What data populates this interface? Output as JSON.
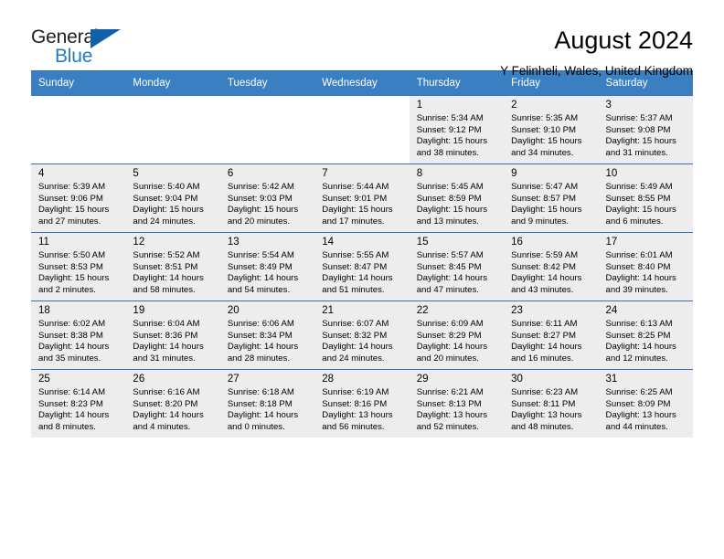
{
  "brand": {
    "name_part1": "General",
    "name_part2": "Blue",
    "logo_icon": "triangle-flag-icon",
    "accent_color": "#1161a8",
    "blue_text_color": "#1d7dc4"
  },
  "header": {
    "title": "August 2024",
    "subtitle": "Y Felinheli, Wales, United Kingdom"
  },
  "calendar": {
    "header_bg": "#3a7fc1",
    "header_text_color": "#ffffff",
    "shaded_cell_color": "#ededed",
    "border_color": "#2e74b5",
    "weekday_headers": [
      "Sunday",
      "Monday",
      "Tuesday",
      "Wednesday",
      "Thursday",
      "Friday",
      "Saturday"
    ],
    "weeks": [
      [
        {
          "day": "",
          "sunrise": "",
          "sunset": "",
          "daylight_line1": "",
          "daylight_line2": ""
        },
        {
          "day": "",
          "sunrise": "",
          "sunset": "",
          "daylight_line1": "",
          "daylight_line2": ""
        },
        {
          "day": "",
          "sunrise": "",
          "sunset": "",
          "daylight_line1": "",
          "daylight_line2": ""
        },
        {
          "day": "",
          "sunrise": "",
          "sunset": "",
          "daylight_line1": "",
          "daylight_line2": ""
        },
        {
          "day": "1",
          "sunrise": "Sunrise: 5:34 AM",
          "sunset": "Sunset: 9:12 PM",
          "daylight_line1": "Daylight: 15 hours",
          "daylight_line2": "and 38 minutes."
        },
        {
          "day": "2",
          "sunrise": "Sunrise: 5:35 AM",
          "sunset": "Sunset: 9:10 PM",
          "daylight_line1": "Daylight: 15 hours",
          "daylight_line2": "and 34 minutes."
        },
        {
          "day": "3",
          "sunrise": "Sunrise: 5:37 AM",
          "sunset": "Sunset: 9:08 PM",
          "daylight_line1": "Daylight: 15 hours",
          "daylight_line2": "and 31 minutes."
        }
      ],
      [
        {
          "day": "4",
          "sunrise": "Sunrise: 5:39 AM",
          "sunset": "Sunset: 9:06 PM",
          "daylight_line1": "Daylight: 15 hours",
          "daylight_line2": "and 27 minutes."
        },
        {
          "day": "5",
          "sunrise": "Sunrise: 5:40 AM",
          "sunset": "Sunset: 9:04 PM",
          "daylight_line1": "Daylight: 15 hours",
          "daylight_line2": "and 24 minutes."
        },
        {
          "day": "6",
          "sunrise": "Sunrise: 5:42 AM",
          "sunset": "Sunset: 9:03 PM",
          "daylight_line1": "Daylight: 15 hours",
          "daylight_line2": "and 20 minutes."
        },
        {
          "day": "7",
          "sunrise": "Sunrise: 5:44 AM",
          "sunset": "Sunset: 9:01 PM",
          "daylight_line1": "Daylight: 15 hours",
          "daylight_line2": "and 17 minutes."
        },
        {
          "day": "8",
          "sunrise": "Sunrise: 5:45 AM",
          "sunset": "Sunset: 8:59 PM",
          "daylight_line1": "Daylight: 15 hours",
          "daylight_line2": "and 13 minutes."
        },
        {
          "day": "9",
          "sunrise": "Sunrise: 5:47 AM",
          "sunset": "Sunset: 8:57 PM",
          "daylight_line1": "Daylight: 15 hours",
          "daylight_line2": "and 9 minutes."
        },
        {
          "day": "10",
          "sunrise": "Sunrise: 5:49 AM",
          "sunset": "Sunset: 8:55 PM",
          "daylight_line1": "Daylight: 15 hours",
          "daylight_line2": "and 6 minutes."
        }
      ],
      [
        {
          "day": "11",
          "sunrise": "Sunrise: 5:50 AM",
          "sunset": "Sunset: 8:53 PM",
          "daylight_line1": "Daylight: 15 hours",
          "daylight_line2": "and 2 minutes."
        },
        {
          "day": "12",
          "sunrise": "Sunrise: 5:52 AM",
          "sunset": "Sunset: 8:51 PM",
          "daylight_line1": "Daylight: 14 hours",
          "daylight_line2": "and 58 minutes."
        },
        {
          "day": "13",
          "sunrise": "Sunrise: 5:54 AM",
          "sunset": "Sunset: 8:49 PM",
          "daylight_line1": "Daylight: 14 hours",
          "daylight_line2": "and 54 minutes."
        },
        {
          "day": "14",
          "sunrise": "Sunrise: 5:55 AM",
          "sunset": "Sunset: 8:47 PM",
          "daylight_line1": "Daylight: 14 hours",
          "daylight_line2": "and 51 minutes."
        },
        {
          "day": "15",
          "sunrise": "Sunrise: 5:57 AM",
          "sunset": "Sunset: 8:45 PM",
          "daylight_line1": "Daylight: 14 hours",
          "daylight_line2": "and 47 minutes."
        },
        {
          "day": "16",
          "sunrise": "Sunrise: 5:59 AM",
          "sunset": "Sunset: 8:42 PM",
          "daylight_line1": "Daylight: 14 hours",
          "daylight_line2": "and 43 minutes."
        },
        {
          "day": "17",
          "sunrise": "Sunrise: 6:01 AM",
          "sunset": "Sunset: 8:40 PM",
          "daylight_line1": "Daylight: 14 hours",
          "daylight_line2": "and 39 minutes."
        }
      ],
      [
        {
          "day": "18",
          "sunrise": "Sunrise: 6:02 AM",
          "sunset": "Sunset: 8:38 PM",
          "daylight_line1": "Daylight: 14 hours",
          "daylight_line2": "and 35 minutes."
        },
        {
          "day": "19",
          "sunrise": "Sunrise: 6:04 AM",
          "sunset": "Sunset: 8:36 PM",
          "daylight_line1": "Daylight: 14 hours",
          "daylight_line2": "and 31 minutes."
        },
        {
          "day": "20",
          "sunrise": "Sunrise: 6:06 AM",
          "sunset": "Sunset: 8:34 PM",
          "daylight_line1": "Daylight: 14 hours",
          "daylight_line2": "and 28 minutes."
        },
        {
          "day": "21",
          "sunrise": "Sunrise: 6:07 AM",
          "sunset": "Sunset: 8:32 PM",
          "daylight_line1": "Daylight: 14 hours",
          "daylight_line2": "and 24 minutes."
        },
        {
          "day": "22",
          "sunrise": "Sunrise: 6:09 AM",
          "sunset": "Sunset: 8:29 PM",
          "daylight_line1": "Daylight: 14 hours",
          "daylight_line2": "and 20 minutes."
        },
        {
          "day": "23",
          "sunrise": "Sunrise: 6:11 AM",
          "sunset": "Sunset: 8:27 PM",
          "daylight_line1": "Daylight: 14 hours",
          "daylight_line2": "and 16 minutes."
        },
        {
          "day": "24",
          "sunrise": "Sunrise: 6:13 AM",
          "sunset": "Sunset: 8:25 PM",
          "daylight_line1": "Daylight: 14 hours",
          "daylight_line2": "and 12 minutes."
        }
      ],
      [
        {
          "day": "25",
          "sunrise": "Sunrise: 6:14 AM",
          "sunset": "Sunset: 8:23 PM",
          "daylight_line1": "Daylight: 14 hours",
          "daylight_line2": "and 8 minutes."
        },
        {
          "day": "26",
          "sunrise": "Sunrise: 6:16 AM",
          "sunset": "Sunset: 8:20 PM",
          "daylight_line1": "Daylight: 14 hours",
          "daylight_line2": "and 4 minutes."
        },
        {
          "day": "27",
          "sunrise": "Sunrise: 6:18 AM",
          "sunset": "Sunset: 8:18 PM",
          "daylight_line1": "Daylight: 14 hours",
          "daylight_line2": "and 0 minutes."
        },
        {
          "day": "28",
          "sunrise": "Sunrise: 6:19 AM",
          "sunset": "Sunset: 8:16 PM",
          "daylight_line1": "Daylight: 13 hours",
          "daylight_line2": "and 56 minutes."
        },
        {
          "day": "29",
          "sunrise": "Sunrise: 6:21 AM",
          "sunset": "Sunset: 8:13 PM",
          "daylight_line1": "Daylight: 13 hours",
          "daylight_line2": "and 52 minutes."
        },
        {
          "day": "30",
          "sunrise": "Sunrise: 6:23 AM",
          "sunset": "Sunset: 8:11 PM",
          "daylight_line1": "Daylight: 13 hours",
          "daylight_line2": "and 48 minutes."
        },
        {
          "day": "31",
          "sunrise": "Sunrise: 6:25 AM",
          "sunset": "Sunset: 8:09 PM",
          "daylight_line1": "Daylight: 13 hours",
          "daylight_line2": "and 44 minutes."
        }
      ]
    ]
  }
}
